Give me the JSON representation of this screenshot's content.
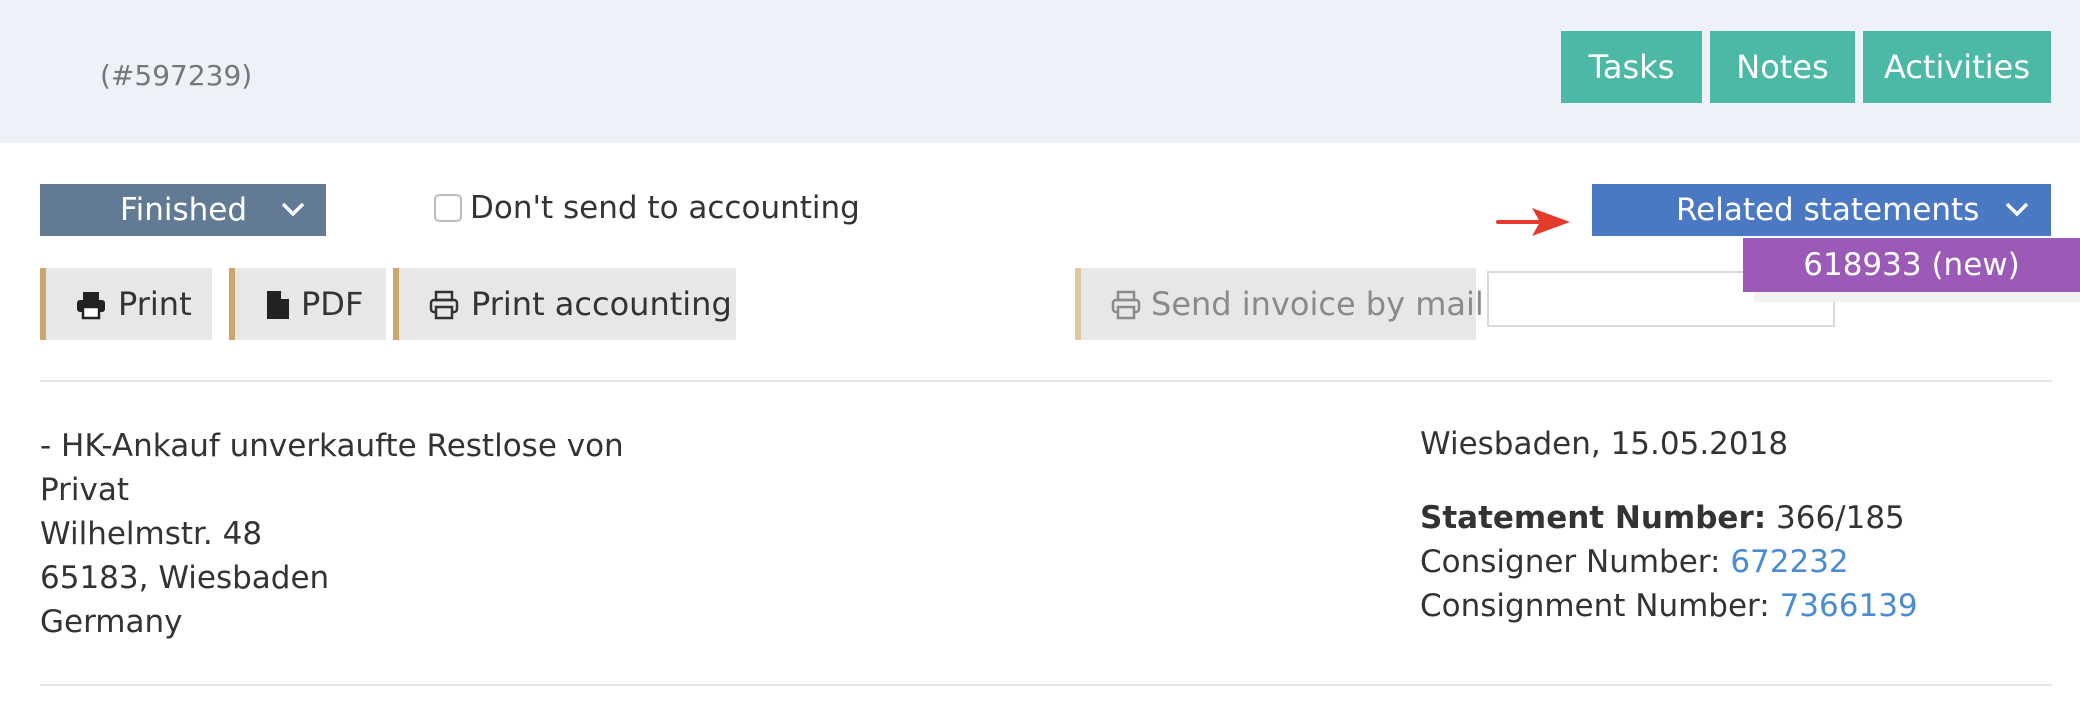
{
  "header": {
    "record_id": "(#597239)",
    "buttons": [
      {
        "label": "Tasks"
      },
      {
        "label": "Notes"
      },
      {
        "label": "Activities"
      }
    ]
  },
  "toolbar": {
    "status": {
      "selected": "Finished"
    },
    "accounting_checkbox": {
      "label": "Don't send to accounting",
      "checked": false
    },
    "related_statements": {
      "label": "Related statements",
      "items": [
        {
          "label": "618933 (new)"
        }
      ]
    },
    "actions": {
      "print": "Print",
      "pdf": "PDF",
      "print_accounting": "Print accounting",
      "send_mail": "Send invoice by mail"
    },
    "mail_input": {
      "value": "",
      "placeholder": ""
    }
  },
  "address": {
    "lines": [
      "- HK-Ankauf unverkaufte Restlose von",
      "Privat",
      "Wilhelmstr. 48",
      "65183, Wiesbaden",
      "Germany"
    ]
  },
  "statement": {
    "place_date": "Wiesbaden, 15.05.2018",
    "statement_number_label": "Statement Number:",
    "statement_number": "366/185",
    "consigner_label": "Consigner Number:",
    "consigner_number": "672232",
    "consignment_label": "Consignment Number:",
    "consignment_number": "7366139"
  },
  "colors": {
    "header_bg": "#eef2f8",
    "teal": "#4cb8a6",
    "status_dropdown": "#627a93",
    "related_dropdown": "#4a78c2",
    "popup": "#9b5ab7",
    "accent_border": "#c9a86b",
    "link": "#4b8bd1",
    "arrow": "#e53b2c"
  }
}
